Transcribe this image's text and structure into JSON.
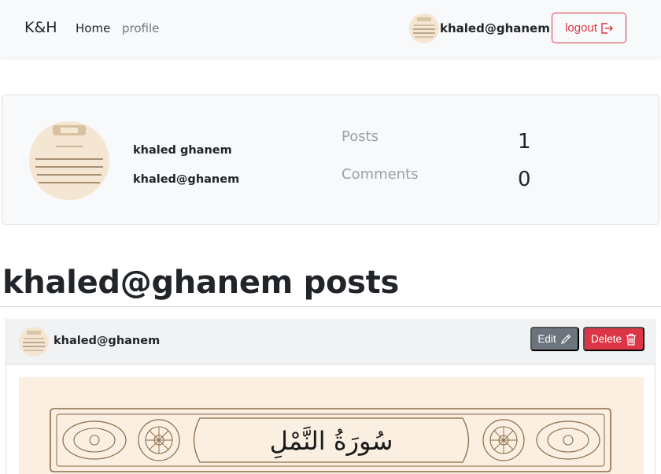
{
  "nav": {
    "brand": "K&H",
    "home": "Home",
    "profile": "profile",
    "user": "khaled@ghanem",
    "logout": "logout"
  },
  "profile": {
    "name": "khaled ghanem",
    "email": "khaled@ghanem",
    "posts_label": "Posts",
    "posts_count": "1",
    "comments_label": "Comments",
    "comments_count": "0"
  },
  "section": {
    "title": "khaled@ghanem posts"
  },
  "post": {
    "user": "khaled@ghanem",
    "edit": "Edit",
    "delete": "Delete",
    "image_heading": "سُورَةُ النَّمْلِ"
  },
  "colors": {
    "danger": "#dc3545",
    "secondary": "#6c757d",
    "navbar_bg": "#f8f9fa",
    "image_bg": "#fbefe1",
    "ornament": "#8a6a45"
  }
}
